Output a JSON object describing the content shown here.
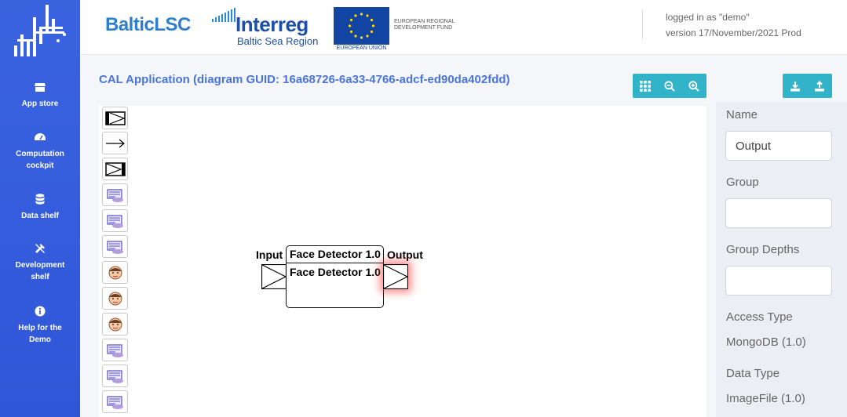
{
  "sidebar": {
    "items": [
      {
        "label": "App store",
        "icon": "store-icon"
      },
      {
        "label": "Computation cockpit",
        "icon": "gauge-icon"
      },
      {
        "label": "Data shelf",
        "icon": "database-icon"
      },
      {
        "label": "Development shelf",
        "icon": "tools-icon"
      },
      {
        "label": "Help for the Demo",
        "icon": "info-icon"
      }
    ]
  },
  "header": {
    "brand": "BalticLSC",
    "interreg": "Interreg",
    "interreg_sub": "Baltic Sea Region",
    "eu_under": "EUROPEAN UNION",
    "eu_text": "EUROPEAN REGIONAL DEVELOPMENT FUND",
    "logged_in": "logged in as \"demo\"",
    "version": "version 17/November/2021 Prod"
  },
  "page": {
    "title": "CAL Application (diagram GUID: 16a68726-6a33-4766-adcf-ed90da402fdd)"
  },
  "toolbar": {
    "view_buttons": [
      "grid-icon",
      "zoom-out-icon",
      "zoom-in-icon"
    ],
    "file_buttons": [
      "download-icon",
      "upload-icon"
    ]
  },
  "diagram": {
    "component_title": "Face Detector 1.0",
    "component_subtitle": "Face Detector 1.0",
    "input_label": "Input",
    "output_label": "Output"
  },
  "properties": {
    "name_label": "Name",
    "name_value": "Output",
    "group_label": "Group",
    "group_value": "",
    "group_depths_label": "Group Depths",
    "group_depths_value": "",
    "access_type_label": "Access Type",
    "access_type_value": "MongoDB (1.0)",
    "data_type_label": "Data Type",
    "data_type_value": "ImageFile (1.0)"
  },
  "colors": {
    "sidebar": "#3a63e0",
    "accent": "#31b3c9",
    "title": "#4a74d8"
  }
}
